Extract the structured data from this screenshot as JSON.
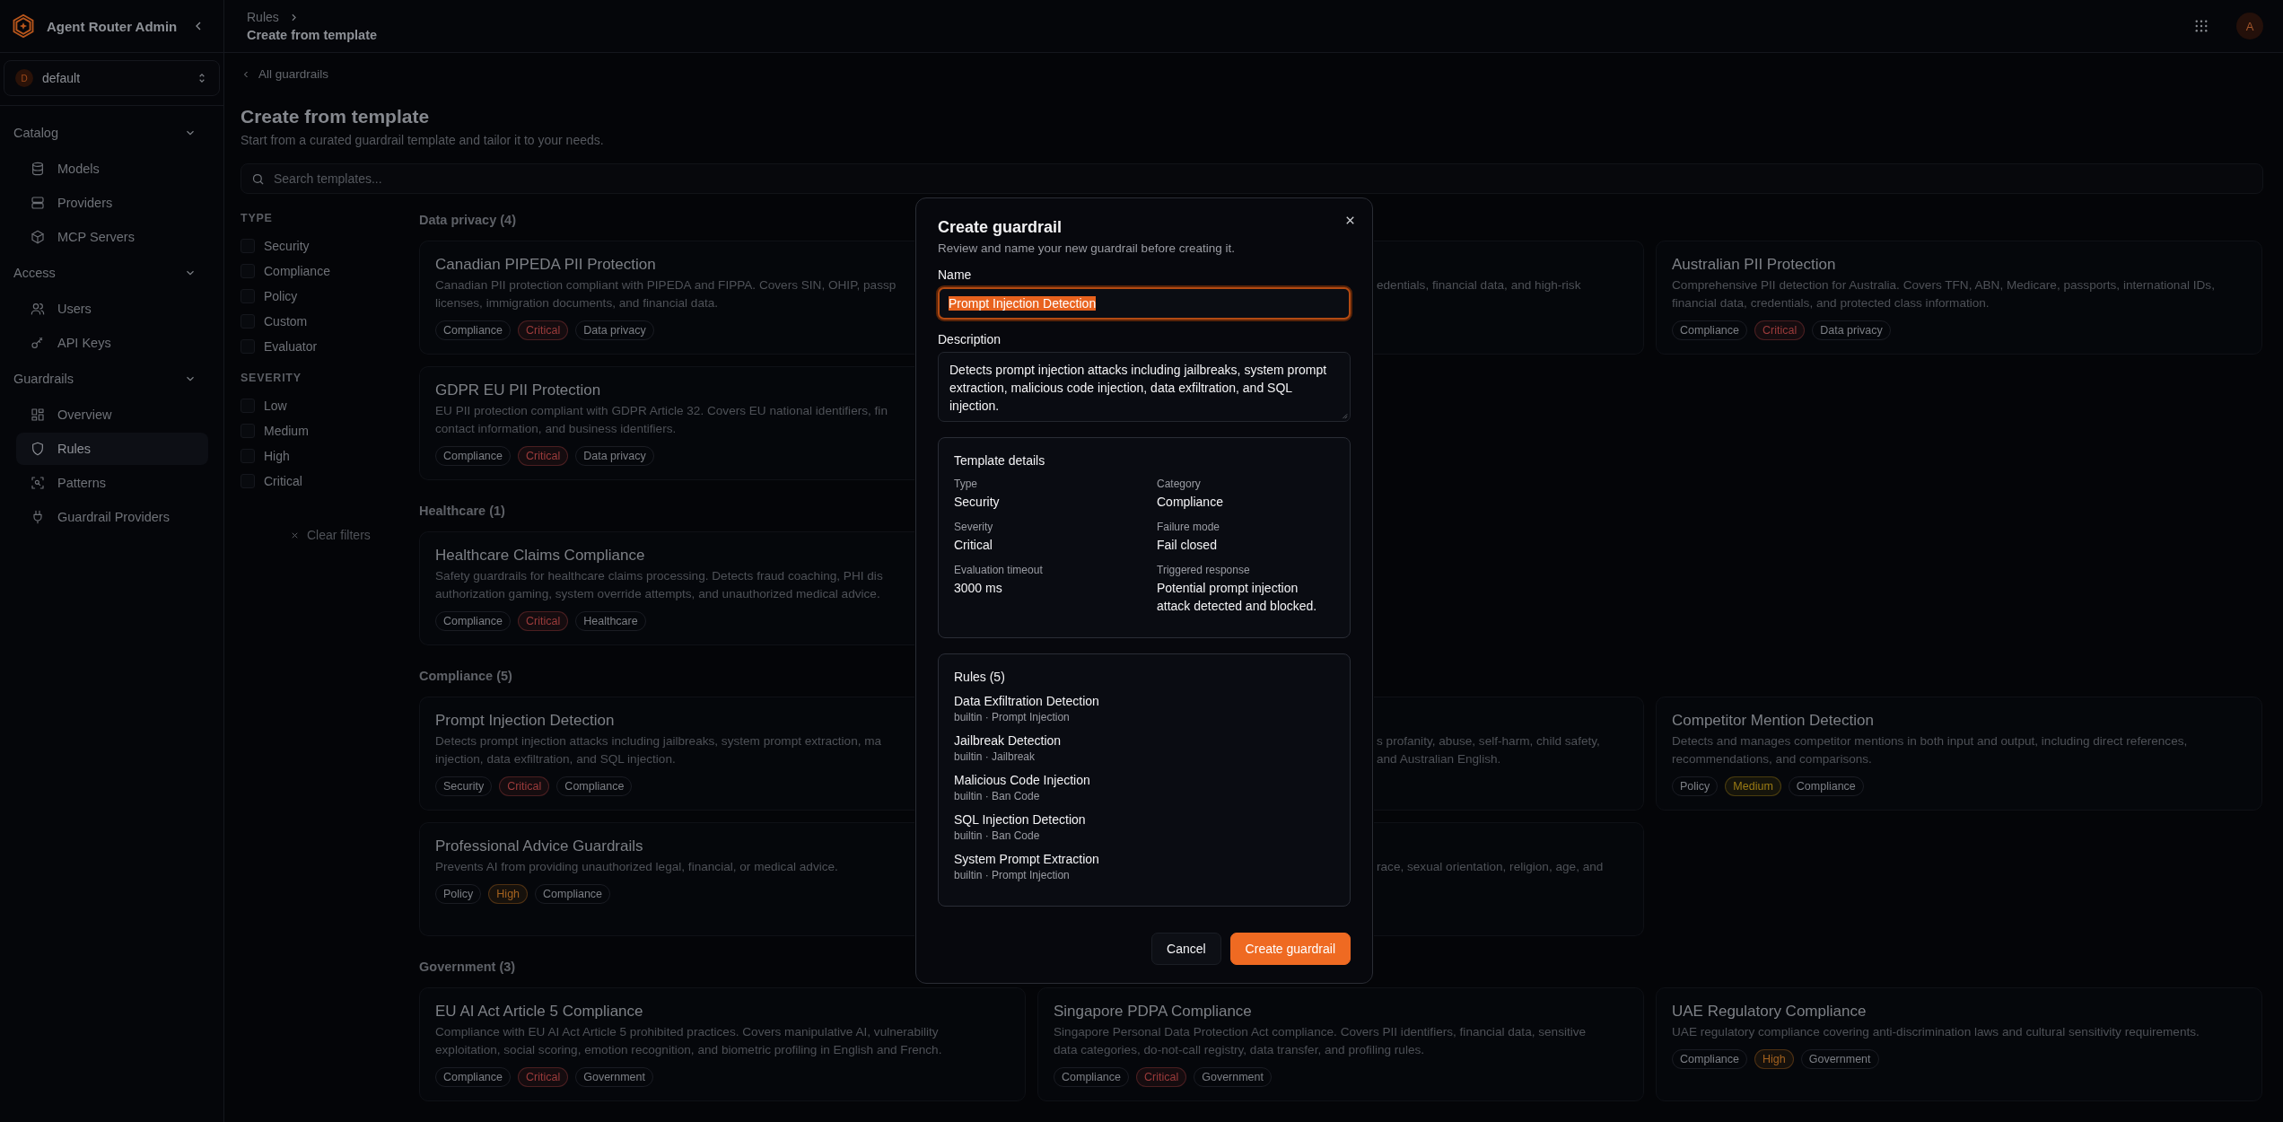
{
  "sidebar": {
    "app_title": "Agent Router Admin",
    "workspace": {
      "initial": "D",
      "name": "default"
    },
    "sections": [
      {
        "label": "Catalog",
        "expanded": true,
        "items": [
          {
            "label": "Models",
            "selected": false
          },
          {
            "label": "Providers",
            "selected": false
          },
          {
            "label": "MCP Servers",
            "selected": false
          }
        ]
      },
      {
        "label": "Access",
        "expanded": true,
        "items": [
          {
            "label": "Users",
            "selected": false
          },
          {
            "label": "API Keys",
            "selected": false
          }
        ]
      },
      {
        "label": "Guardrails",
        "expanded": true,
        "items": [
          {
            "label": "Overview",
            "selected": false
          },
          {
            "label": "Rules",
            "selected": true
          },
          {
            "label": "Patterns",
            "selected": false
          },
          {
            "label": "Guardrail Providers",
            "selected": false
          }
        ]
      }
    ]
  },
  "header": {
    "breadcrumb": "Rules",
    "current": "Create from template",
    "user_initial": "A"
  },
  "page": {
    "back_link": "All guardrails",
    "title": "Create from template",
    "subtitle": "Start from a curated guardrail template and tailor it to your needs.",
    "search": {
      "placeholder": "Search templates..."
    }
  },
  "filters": {
    "groups": [
      {
        "heading": "TYPE",
        "options": [
          {
            "label": "Security",
            "checked": false
          },
          {
            "label": "Compliance",
            "checked": false
          },
          {
            "label": "Policy",
            "checked": false
          },
          {
            "label": "Custom",
            "checked": false
          },
          {
            "label": "Evaluator",
            "checked": false
          }
        ]
      },
      {
        "heading": "SEVERITY",
        "options": [
          {
            "label": "Low",
            "checked": false
          },
          {
            "label": "Medium",
            "checked": false
          },
          {
            "label": "High",
            "checked": false
          },
          {
            "label": "Critical",
            "checked": false
          }
        ]
      }
    ],
    "clear_filters": "Clear filters"
  },
  "sections": [
    {
      "heading": "Data privacy (4)",
      "cards": [
        {
          "title": "Canadian PIPEDA PII Protection",
          "left_side_hidden": false,
          "right_side_hidden": true,
          "description_lines": [
            "Canadian PII protection compliant with PIPEDA and FIPPA. Covers SIN, OHIP, passp",
            "licenses, immigration documents, and financial data."
          ],
          "tags": [
            {
              "label": "Compliance"
            },
            {
              "label": "Critical",
              "color": "#9b3b3b"
            },
            {
              "label": "Data privacy"
            }
          ]
        },
        {
          "left_side_hidden": true,
          "right_side_hidden": false,
          "description_lines": [
            "edentials, financial data, and high-risk"
          ]
        },
        {
          "title": "Australian PII Protection",
          "left_side_hidden": false,
          "right_side_hidden": false,
          "description_lines": [
            "Comprehensive PII detection for Australia. Covers TFN, ABN, Medicare, passports, international IDs,",
            "financial data, credentials, and protected class information."
          ],
          "tags": [
            {
              "label": "Compliance"
            },
            {
              "label": "Critical",
              "color": "#9b3b3b"
            },
            {
              "label": "Data privacy"
            }
          ]
        },
        {
          "title": "GDPR EU PII Protection",
          "left_side_hidden": false,
          "right_side_hidden": true,
          "description_lines": [
            "EU PII protection compliant with GDPR Article 32. Covers EU national identifiers, fin",
            "contact information, and business identifiers."
          ],
          "tags": [
            {
              "label": "Compliance"
            },
            {
              "label": "Critical",
              "color": "#9b3b3b"
            },
            {
              "label": "Data privacy"
            }
          ]
        }
      ]
    },
    {
      "heading": "Healthcare (1)",
      "cards": [
        {
          "title": "Healthcare Claims Compliance",
          "left_side_hidden": false,
          "right_side_hidden": true,
          "description_lines": [
            "Safety guardrails for healthcare claims processing. Detects fraud coaching, PHI dis",
            "authorization gaming, system override attempts, and unauthorized medical advice."
          ],
          "tags": [
            {
              "label": "Compliance"
            },
            {
              "label": "Critical",
              "color": "#9b3b3b"
            },
            {
              "label": "Healthcare"
            }
          ]
        }
      ]
    },
    {
      "heading": "Compliance (5)",
      "cards": [
        {
          "title": "Prompt Injection Detection",
          "left_side_hidden": false,
          "right_side_hidden": true,
          "description_lines": [
            "Detects prompt injection attacks including jailbreaks, system prompt extraction, ma",
            "injection, data exfiltration, and SQL injection."
          ],
          "tags": [
            {
              "label": "Security"
            },
            {
              "label": "Critical",
              "color": "#9b3b3b"
            },
            {
              "label": "Compliance"
            }
          ]
        },
        {
          "left_side_hidden": true,
          "right_side_hidden": false,
          "description_lines": [
            "s profanity, abuse, self-harm, child safety,",
            "and Australian English."
          ]
        },
        {
          "title": "Competitor Mention Detection",
          "left_side_hidden": false,
          "right_side_hidden": false,
          "description_lines": [
            "Detects and manages competitor mentions in both input and output, including direct references,",
            "recommendations, and comparisons."
          ],
          "tags": [
            {
              "label": "Policy"
            },
            {
              "label": "Medium",
              "color": "#9a7b14"
            },
            {
              "label": "Compliance"
            }
          ]
        },
        {
          "title": "Professional Advice Guardrails",
          "left_side_hidden": false,
          "right_side_hidden": true,
          "description_lines": [
            "Prevents AI from providing unauthorized legal, financial, or medical advice."
          ],
          "tags": [
            {
              "label": "Policy"
            },
            {
              "label": "High",
              "color": "#a4621f"
            },
            {
              "label": "Compliance"
            }
          ]
        },
        {
          "left_side_hidden": true,
          "right_side_hidden": false,
          "description_lines": [
            "race, sexual orientation, religion, age, and"
          ]
        }
      ]
    },
    {
      "heading": "Government (3)",
      "cards": [
        {
          "title": "EU AI Act Article 5 Compliance",
          "left_side_hidden": false,
          "right_side_hidden": false,
          "description_lines": [
            "Compliance with EU AI Act Article 5 prohibited practices. Covers manipulative AI, vulnerability",
            "exploitation, social scoring, emotion recognition, and biometric profiling in English and French."
          ],
          "tags": [
            {
              "label": "Compliance"
            },
            {
              "label": "Critical",
              "color": "#9b3b3b"
            },
            {
              "label": "Government"
            }
          ]
        },
        {
          "title": "Singapore PDPA Compliance",
          "left_side_hidden": false,
          "right_side_hidden": false,
          "description_lines": [
            "Singapore Personal Data Protection Act compliance. Covers PII identifiers, financial data, sensitive",
            "data categories, do-not-call registry, data transfer, and profiling rules."
          ],
          "tags": [
            {
              "label": "Compliance"
            },
            {
              "label": "Critical",
              "color": "#9b3b3b"
            },
            {
              "label": "Government"
            }
          ]
        },
        {
          "title": "UAE Regulatory Compliance",
          "left_side_hidden": false,
          "right_side_hidden": false,
          "description_lines": [
            "UAE regulatory compliance covering anti-discrimination laws and cultural sensitivity requirements."
          ],
          "tags": [
            {
              "label": "Compliance"
            },
            {
              "label": "High",
              "color": "#a4621f"
            },
            {
              "label": "Government"
            }
          ]
        }
      ]
    }
  ],
  "dialog": {
    "title": "Create guardrail",
    "subtitle": "Review and name your new guardrail before creating it.",
    "name_label": "Name",
    "name_value": "Prompt Injection Detection",
    "name_text_selected": true,
    "description_label": "Description",
    "description_value": "Detects prompt injection attacks including jailbreaks, system prompt extraction, malicious code injection, data exfiltration, and SQL injection.",
    "details": {
      "heading": "Template details",
      "fields": [
        {
          "label": "Type",
          "value": "Security"
        },
        {
          "label": "Category",
          "value": "Compliance"
        },
        {
          "label": "Severity",
          "value": "Critical"
        },
        {
          "label": "Failure mode",
          "value": "Fail closed"
        },
        {
          "label": "Evaluation timeout",
          "value": "3000 ms"
        },
        {
          "label": "Triggered response",
          "value": "Potential prompt injection attack detected and blocked."
        }
      ]
    },
    "rules": {
      "heading": "Rules (5)",
      "items": [
        {
          "name": "Data Exfiltration Detection",
          "meta": "builtin · Prompt Injection"
        },
        {
          "name": "Jailbreak Detection",
          "meta": "builtin · Jailbreak"
        },
        {
          "name": "Malicious Code Injection",
          "meta": "builtin · Ban Code"
        },
        {
          "name": "SQL Injection Detection",
          "meta": "builtin · Ban Code"
        },
        {
          "name": "System Prompt Extraction",
          "meta": "builtin · Prompt Injection"
        }
      ]
    },
    "cancel": "Cancel",
    "confirm": "Create guardrail"
  }
}
